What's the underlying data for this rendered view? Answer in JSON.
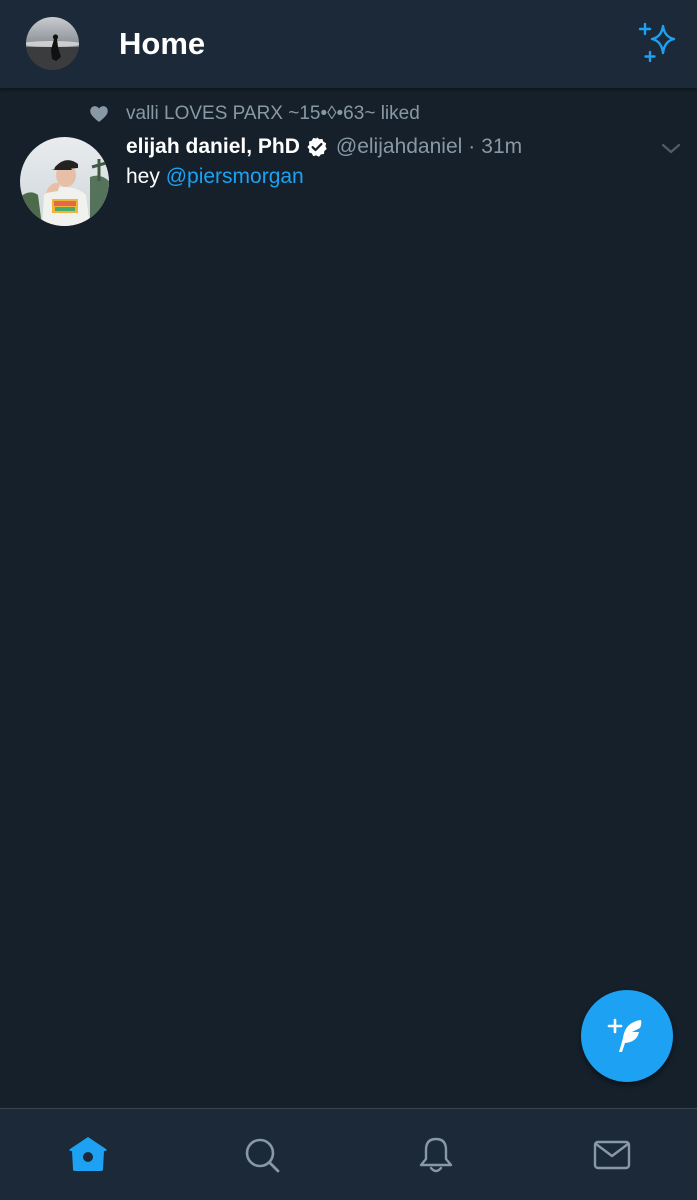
{
  "header": {
    "title": "Home",
    "profile_icon": "profile-avatar",
    "action_icon": "sparkle-icon"
  },
  "tweet": {
    "social_context": {
      "icon": "heart-icon",
      "text": "valli LOVES PARX ~15•◊•63~ liked"
    },
    "author": {
      "display_name": "elijah daniel, PhD",
      "verified": true,
      "handle": "@elijahdaniel"
    },
    "separator": "·",
    "timestamp": "31m",
    "body": {
      "text": "hey",
      "mention": "@piersmorgan"
    },
    "menu_icon": "chevron-down-icon"
  },
  "compose": {
    "icon": "compose-tweet-icon"
  },
  "bottom_nav": {
    "items": [
      {
        "icon": "home-icon",
        "active": true
      },
      {
        "icon": "search-icon",
        "active": false
      },
      {
        "icon": "bell-icon",
        "active": false
      },
      {
        "icon": "mail-icon",
        "active": false
      }
    ]
  },
  "colors": {
    "background": "#15202b",
    "bar": "#1c2938",
    "accent": "#1da1f2",
    "muted": "#8899a6"
  }
}
